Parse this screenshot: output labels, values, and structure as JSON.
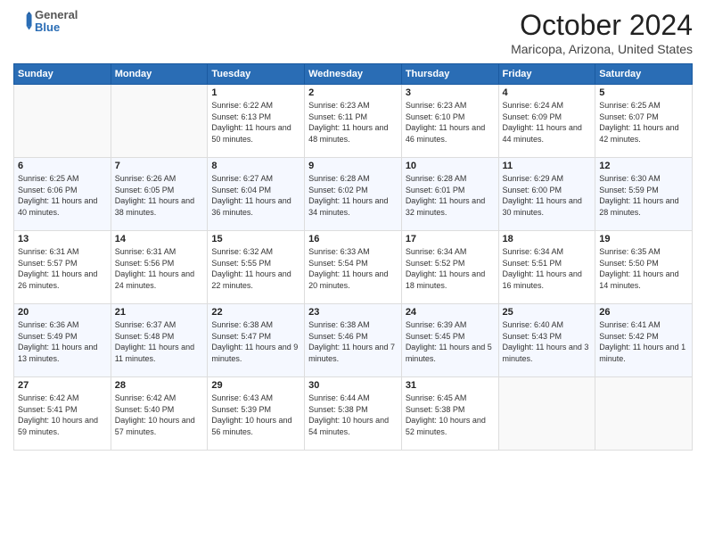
{
  "logo": {
    "general": "General",
    "blue": "Blue"
  },
  "header": {
    "month": "October 2024",
    "location": "Maricopa, Arizona, United States"
  },
  "days_of_week": [
    "Sunday",
    "Monday",
    "Tuesday",
    "Wednesday",
    "Thursday",
    "Friday",
    "Saturday"
  ],
  "weeks": [
    [
      {
        "num": "",
        "empty": true
      },
      {
        "num": "",
        "empty": true
      },
      {
        "num": "1",
        "sunrise": "6:22 AM",
        "sunset": "6:13 PM",
        "daylight": "11 hours and 50 minutes."
      },
      {
        "num": "2",
        "sunrise": "6:23 AM",
        "sunset": "6:11 PM",
        "daylight": "11 hours and 48 minutes."
      },
      {
        "num": "3",
        "sunrise": "6:23 AM",
        "sunset": "6:10 PM",
        "daylight": "11 hours and 46 minutes."
      },
      {
        "num": "4",
        "sunrise": "6:24 AM",
        "sunset": "6:09 PM",
        "daylight": "11 hours and 44 minutes."
      },
      {
        "num": "5",
        "sunrise": "6:25 AM",
        "sunset": "6:07 PM",
        "daylight": "11 hours and 42 minutes."
      }
    ],
    [
      {
        "num": "6",
        "sunrise": "6:25 AM",
        "sunset": "6:06 PM",
        "daylight": "11 hours and 40 minutes."
      },
      {
        "num": "7",
        "sunrise": "6:26 AM",
        "sunset": "6:05 PM",
        "daylight": "11 hours and 38 minutes."
      },
      {
        "num": "8",
        "sunrise": "6:27 AM",
        "sunset": "6:04 PM",
        "daylight": "11 hours and 36 minutes."
      },
      {
        "num": "9",
        "sunrise": "6:28 AM",
        "sunset": "6:02 PM",
        "daylight": "11 hours and 34 minutes."
      },
      {
        "num": "10",
        "sunrise": "6:28 AM",
        "sunset": "6:01 PM",
        "daylight": "11 hours and 32 minutes."
      },
      {
        "num": "11",
        "sunrise": "6:29 AM",
        "sunset": "6:00 PM",
        "daylight": "11 hours and 30 minutes."
      },
      {
        "num": "12",
        "sunrise": "6:30 AM",
        "sunset": "5:59 PM",
        "daylight": "11 hours and 28 minutes."
      }
    ],
    [
      {
        "num": "13",
        "sunrise": "6:31 AM",
        "sunset": "5:57 PM",
        "daylight": "11 hours and 26 minutes."
      },
      {
        "num": "14",
        "sunrise": "6:31 AM",
        "sunset": "5:56 PM",
        "daylight": "11 hours and 24 minutes."
      },
      {
        "num": "15",
        "sunrise": "6:32 AM",
        "sunset": "5:55 PM",
        "daylight": "11 hours and 22 minutes."
      },
      {
        "num": "16",
        "sunrise": "6:33 AM",
        "sunset": "5:54 PM",
        "daylight": "11 hours and 20 minutes."
      },
      {
        "num": "17",
        "sunrise": "6:34 AM",
        "sunset": "5:52 PM",
        "daylight": "11 hours and 18 minutes."
      },
      {
        "num": "18",
        "sunrise": "6:34 AM",
        "sunset": "5:51 PM",
        "daylight": "11 hours and 16 minutes."
      },
      {
        "num": "19",
        "sunrise": "6:35 AM",
        "sunset": "5:50 PM",
        "daylight": "11 hours and 14 minutes."
      }
    ],
    [
      {
        "num": "20",
        "sunrise": "6:36 AM",
        "sunset": "5:49 PM",
        "daylight": "11 hours and 13 minutes."
      },
      {
        "num": "21",
        "sunrise": "6:37 AM",
        "sunset": "5:48 PM",
        "daylight": "11 hours and 11 minutes."
      },
      {
        "num": "22",
        "sunrise": "6:38 AM",
        "sunset": "5:47 PM",
        "daylight": "11 hours and 9 minutes."
      },
      {
        "num": "23",
        "sunrise": "6:38 AM",
        "sunset": "5:46 PM",
        "daylight": "11 hours and 7 minutes."
      },
      {
        "num": "24",
        "sunrise": "6:39 AM",
        "sunset": "5:45 PM",
        "daylight": "11 hours and 5 minutes."
      },
      {
        "num": "25",
        "sunrise": "6:40 AM",
        "sunset": "5:43 PM",
        "daylight": "11 hours and 3 minutes."
      },
      {
        "num": "26",
        "sunrise": "6:41 AM",
        "sunset": "5:42 PM",
        "daylight": "11 hours and 1 minute."
      }
    ],
    [
      {
        "num": "27",
        "sunrise": "6:42 AM",
        "sunset": "5:41 PM",
        "daylight": "10 hours and 59 minutes."
      },
      {
        "num": "28",
        "sunrise": "6:42 AM",
        "sunset": "5:40 PM",
        "daylight": "10 hours and 57 minutes."
      },
      {
        "num": "29",
        "sunrise": "6:43 AM",
        "sunset": "5:39 PM",
        "daylight": "10 hours and 56 minutes."
      },
      {
        "num": "30",
        "sunrise": "6:44 AM",
        "sunset": "5:38 PM",
        "daylight": "10 hours and 54 minutes."
      },
      {
        "num": "31",
        "sunrise": "6:45 AM",
        "sunset": "5:38 PM",
        "daylight": "10 hours and 52 minutes."
      },
      {
        "num": "",
        "empty": true
      },
      {
        "num": "",
        "empty": true
      }
    ]
  ]
}
